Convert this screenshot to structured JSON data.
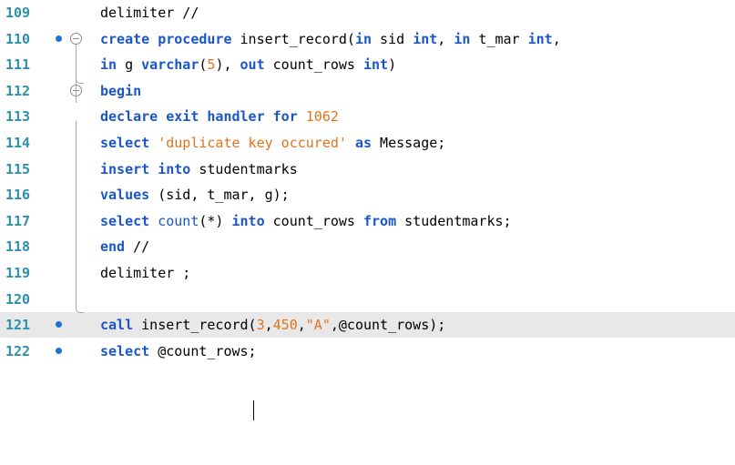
{
  "editor": {
    "lines": [
      {
        "number": "109",
        "tokens": [
          {
            "t": "delimiter //",
            "c": "id"
          }
        ]
      },
      {
        "number": "110",
        "tokens": [
          {
            "t": "create procedure",
            "c": "kw"
          },
          {
            "t": " insert_record(",
            "c": "id"
          },
          {
            "t": "in",
            "c": "kw"
          },
          {
            "t": " sid ",
            "c": "id"
          },
          {
            "t": "int",
            "c": "kw"
          },
          {
            "t": ", ",
            "c": "id"
          },
          {
            "t": "in",
            "c": "kw"
          },
          {
            "t": " t_mar ",
            "c": "id"
          },
          {
            "t": "int",
            "c": "kw"
          },
          {
            "t": ",",
            "c": "id"
          }
        ]
      },
      {
        "number": "111",
        "tokens": [
          {
            "t": "in",
            "c": "kw"
          },
          {
            "t": " g ",
            "c": "id"
          },
          {
            "t": "varchar",
            "c": "kw"
          },
          {
            "t": "(",
            "c": "id"
          },
          {
            "t": "5",
            "c": "num"
          },
          {
            "t": "), ",
            "c": "id"
          },
          {
            "t": "out",
            "c": "kw"
          },
          {
            "t": " count_rows ",
            "c": "id"
          },
          {
            "t": "int",
            "c": "kw"
          },
          {
            "t": ")",
            "c": "id"
          }
        ]
      },
      {
        "number": "112",
        "tokens": [
          {
            "t": "begin",
            "c": "kw"
          }
        ]
      },
      {
        "number": "113",
        "tokens": [
          {
            "t": "declare exit handler for",
            "c": "kw"
          },
          {
            "t": " ",
            "c": "id"
          },
          {
            "t": "1062",
            "c": "num"
          }
        ]
      },
      {
        "number": "114",
        "tokens": [
          {
            "t": "select",
            "c": "kw"
          },
          {
            "t": " ",
            "c": "id"
          },
          {
            "t": "'duplicate key occured'",
            "c": "str"
          },
          {
            "t": " ",
            "c": "id"
          },
          {
            "t": "as",
            "c": "kw"
          },
          {
            "t": " Message;",
            "c": "id"
          }
        ]
      },
      {
        "number": "115",
        "tokens": [
          {
            "t": "insert into",
            "c": "kw"
          },
          {
            "t": " studentmarks",
            "c": "id"
          }
        ]
      },
      {
        "number": "116",
        "tokens": [
          {
            "t": "values",
            "c": "kw"
          },
          {
            "t": " (sid, t_mar, g);",
            "c": "id"
          }
        ]
      },
      {
        "number": "117",
        "tokens": [
          {
            "t": "select",
            "c": "kw"
          },
          {
            "t": " ",
            "c": "id"
          },
          {
            "t": "count",
            "c": "fn"
          },
          {
            "t": "(*) ",
            "c": "id"
          },
          {
            "t": "into",
            "c": "kw"
          },
          {
            "t": " count_rows ",
            "c": "id"
          },
          {
            "t": "from",
            "c": "kw"
          },
          {
            "t": " studentmarks;",
            "c": "id"
          }
        ]
      },
      {
        "number": "118",
        "tokens": [
          {
            "t": "end",
            "c": "kw"
          },
          {
            "t": " //",
            "c": "id"
          }
        ]
      },
      {
        "number": "119",
        "tokens": [
          {
            "t": "delimiter ;",
            "c": "id"
          }
        ]
      },
      {
        "number": "120",
        "tokens": []
      },
      {
        "number": "121",
        "tokens": [
          {
            "t": "call",
            "c": "kw"
          },
          {
            "t": " insert_record(",
            "c": "id"
          },
          {
            "t": "3",
            "c": "num"
          },
          {
            "t": ",",
            "c": "id"
          },
          {
            "t": "450",
            "c": "num"
          },
          {
            "t": ",",
            "c": "id"
          },
          {
            "t": "\"A\"",
            "c": "str"
          },
          {
            "t": ",@count_rows);",
            "c": "id"
          }
        ]
      },
      {
        "number": "122",
        "tokens": [
          {
            "t": "select",
            "c": "kw"
          },
          {
            "t": " @count_rows;",
            "c": "id"
          }
        ]
      }
    ]
  },
  "colors": {
    "line_number": "#2b91af",
    "keyword": "#1a56c8",
    "literal": "#e4721a",
    "identifier": "#000000",
    "statement_marker": "#1a73d9",
    "current_line_bg": "#e8e8e8"
  }
}
